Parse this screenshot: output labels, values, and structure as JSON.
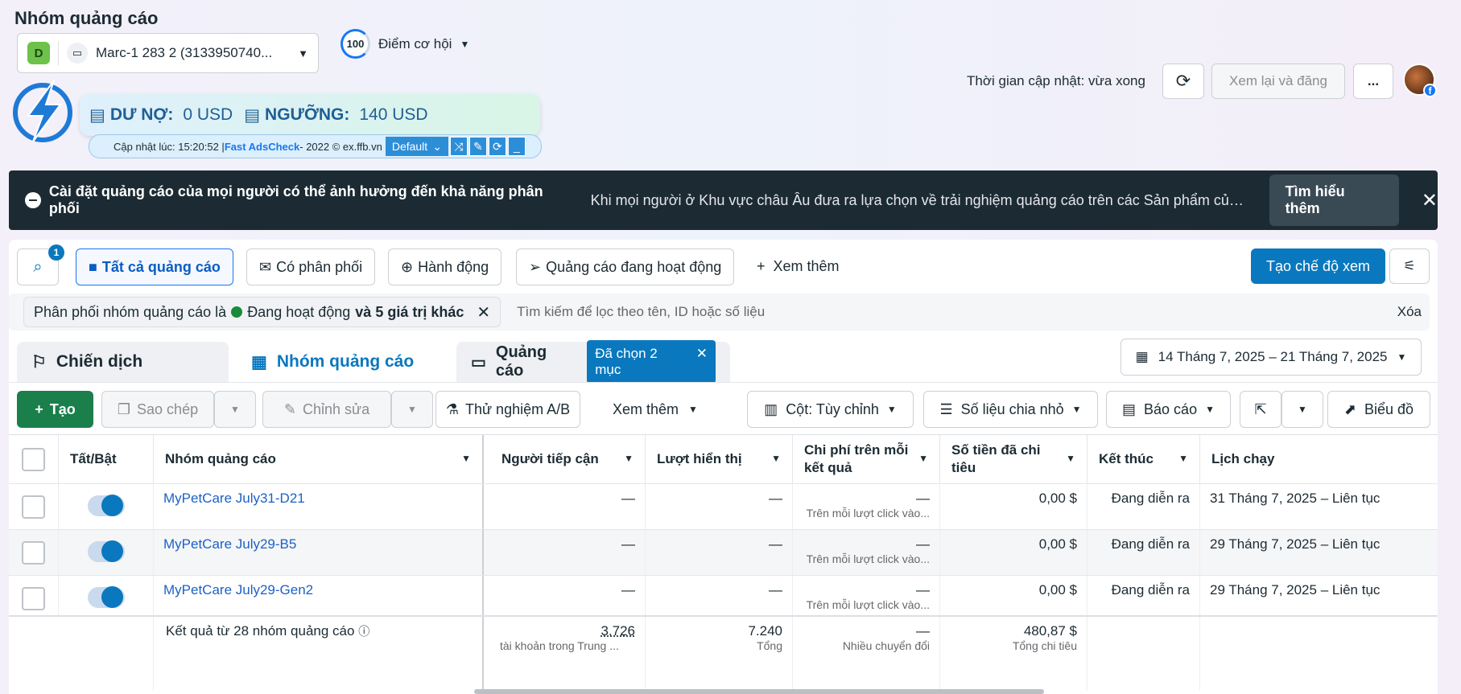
{
  "page_title": "Nhóm quảng cáo",
  "account": {
    "badge": "D",
    "name": "Marc-1 283 2 (3133950740..."
  },
  "opportunity": {
    "score": "100",
    "label": "Điểm cơ hội"
  },
  "header": {
    "update_text": "Thời gian cập nhật: vừa xong",
    "review_label": "Xem lại và đăng",
    "more_label": "..."
  },
  "extension": {
    "debt_label": "DƯ NỢ:",
    "debt_value": "0 USD",
    "threshold_label": "NGƯỠNG:",
    "threshold_value": "140 USD",
    "update_prefix": "Cập nhật lúc: 15:20:52 | ",
    "brand": "Fast AdsCheck",
    "suffix": " - 2022 © ex.ffb.vn",
    "select": "Default"
  },
  "banner": {
    "title": "Cài đặt quảng cáo của mọi người có thể ảnh hưởng đến khả năng phân phối",
    "message": "Khi mọi người ở Khu vực châu Âu đưa ra lựa chọn về trải nghiệm quảng cáo trên các Sản phẩm của chún...",
    "learn_more": "Tìm hiểu thêm"
  },
  "toolbar": {
    "search_badge": "1",
    "filters": [
      "Tất cả quảng cáo",
      "Có phân phối",
      "Hành động",
      "Quảng cáo đang hoạt động"
    ],
    "see_more": "Xem thêm",
    "create_view": "Tạo chế độ xem"
  },
  "filter": {
    "chip_prefix": "Phân phối nhóm quảng cáo là ",
    "chip_value": "Đang hoạt động",
    "chip_suffix": " và 5 giá trị khác",
    "placeholder": "Tìm kiếm để lọc theo tên, ID hoặc số liệu",
    "clear": "Xóa"
  },
  "tabs": {
    "campaigns": "Chiến dịch",
    "adsets": "Nhóm quảng cáo",
    "ads": "Quảng cáo",
    "selected": "Đã chọn 2 mục"
  },
  "date_range": "14 Tháng 7, 2025 – 21 Tháng 7, 2025",
  "actions": {
    "create": "Tạo",
    "duplicate": "Sao chép",
    "edit": "Chỉnh sửa",
    "ab_test": "Thử nghiệm A/B",
    "see_more": "Xem thêm",
    "columns": "Cột: Tùy chỉnh",
    "breakdown": "Số liệu chia nhỏ",
    "reports": "Báo cáo",
    "charts": "Biểu đồ"
  },
  "table": {
    "headers": {
      "toggle": "Tất/Bật",
      "name": "Nhóm quảng cáo",
      "reach": "Người tiếp cận",
      "impressions": "Lượt hiển thị",
      "cost_per_result": "Chi phí trên mỗi kết quả",
      "amount_spent": "Số tiền đã chi tiêu",
      "ends": "Kết thúc",
      "schedule": "Lịch chạy"
    },
    "rows": [
      {
        "name": "MyPetCare July31-D21",
        "reach": "—",
        "impressions": "—",
        "cpr": "—",
        "cpr_sub": "Trên mỗi lượt click vào...",
        "spent": "0,00 $",
        "ends": "Đang diễn ra",
        "schedule": "31 Tháng 7, 2025 – Liên tục"
      },
      {
        "name": "MyPetCare July29-B5",
        "reach": "—",
        "impressions": "—",
        "cpr": "—",
        "cpr_sub": "Trên mỗi lượt click vào...",
        "spent": "0,00 $",
        "ends": "Đang diễn ra",
        "schedule": "29 Tháng 7, 2025 – Liên tục"
      },
      {
        "name": "MyPetCare July29-Gen2",
        "reach": "—",
        "impressions": "—",
        "cpr": "—",
        "cpr_sub": "Trên mỗi lượt click vào...",
        "spent": "0,00 $",
        "ends": "Đang diễn ra",
        "schedule": "29 Tháng 7, 2025 – Liên tục"
      }
    ],
    "summary": {
      "label": "Kết quả từ 28 nhóm quảng cáo",
      "reach": "3.726",
      "reach_sub": "tài khoản trong Trung ...",
      "impressions": "7.240",
      "impressions_sub": "Tổng",
      "cpr": "—",
      "cpr_sub": "Nhiều chuyển đổi",
      "spent": "480,87 $",
      "spent_sub": "Tổng chi tiêu"
    }
  }
}
